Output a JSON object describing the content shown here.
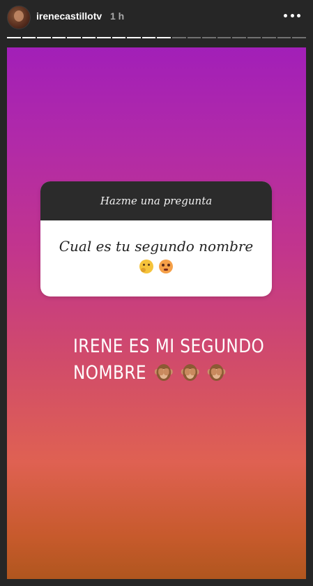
{
  "header": {
    "username": "irenecastillotv",
    "time_ago": "1 h"
  },
  "progress": {
    "segments_total": 20,
    "segments_viewed": 11
  },
  "question_sticker": {
    "header": "Hazme una pregunta",
    "question": "Cual es tu segundo nombre",
    "emojis": [
      "thinking-face-icon",
      "flushed-face-icon"
    ]
  },
  "answer": {
    "line1": "IRENE ES MI SEGUNDO",
    "line2": "NOMBRE",
    "emojis": [
      "see-no-evil-monkey-icon",
      "see-no-evil-monkey-icon",
      "see-no-evil-monkey-icon"
    ]
  },
  "colors": {
    "background": "#262626",
    "gradient_top": "#a21fb8",
    "gradient_bottom": "#b0561e"
  }
}
